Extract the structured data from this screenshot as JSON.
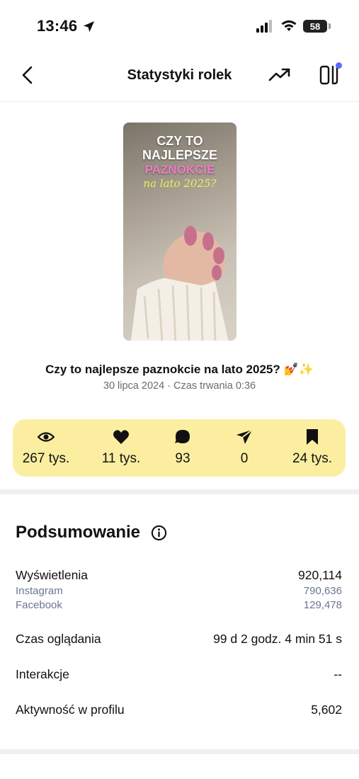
{
  "status_bar": {
    "time": "13:46",
    "battery": "58"
  },
  "nav": {
    "title": "Statystyki rolek"
  },
  "reel": {
    "thumbnail": {
      "line1": "CZY TO",
      "line1b": "NAJLEPSZE",
      "line2": "PAZNOKCIE",
      "line3": "na lato 2025?"
    },
    "title": "Czy to najlepsze paznokcie na lato 2025? 💅✨",
    "meta": "30 lipca 2024 · Czas trwania 0:36"
  },
  "stats": [
    {
      "icon": "eye-icon",
      "value": "267 tys."
    },
    {
      "icon": "heart-icon",
      "value": "11 tys."
    },
    {
      "icon": "comment-icon",
      "value": "93"
    },
    {
      "icon": "send-icon",
      "value": "0"
    },
    {
      "icon": "bookmark-icon",
      "value": "24 tys."
    }
  ],
  "stats_color": "#fbeea0",
  "summary": {
    "title": "Podsumowanie",
    "views": {
      "label": "Wyświetlenia",
      "value": "920,114"
    },
    "instagram": {
      "label": "Instagram",
      "value": "790,636"
    },
    "facebook": {
      "label": "Facebook",
      "value": "129,478"
    },
    "watch_time": {
      "label": "Czas oglądania",
      "value": "99 d 2 godz. 4 min 51 s"
    },
    "interactions": {
      "label": "Interakcje",
      "value": "--"
    },
    "profile_activity": {
      "label": "Aktywność w profilu",
      "value": "5,602"
    }
  }
}
